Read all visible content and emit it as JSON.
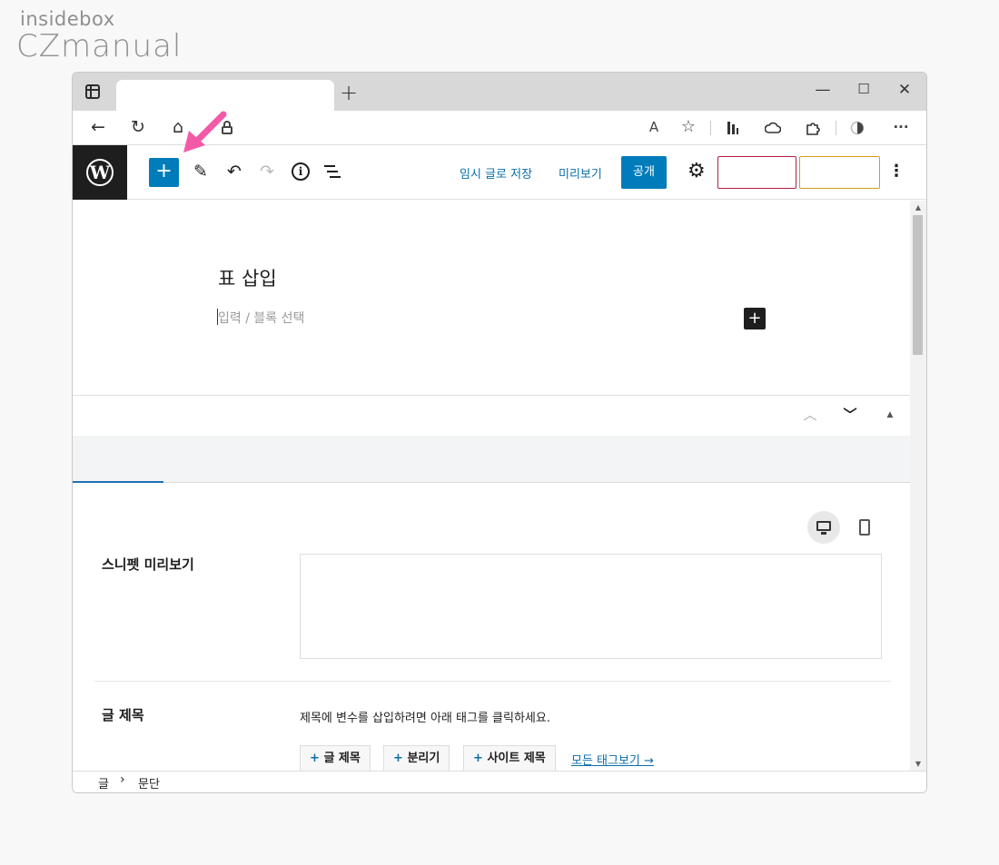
{
  "watermark": {
    "line1": "insidebox",
    "line2": "CZmanual"
  },
  "browser": {
    "new_tab_glyph": "+",
    "window_controls": {
      "minimize": "—",
      "maximize": "☐",
      "close": "✕"
    },
    "nav": {
      "back": "←",
      "reload": "↻",
      "home": "⌂"
    },
    "toolbar_icons": {
      "read_aloud": "A",
      "favorite": "☆",
      "more": "···"
    }
  },
  "wp_toolbar": {
    "logo_letter": "W",
    "insert_glyph": "+",
    "tools_glyph": "✎",
    "undo_glyph": "↶",
    "redo_glyph": "↷",
    "info_glyph": "i",
    "save_draft": "임시 글로 저장",
    "preview": "미리보기",
    "publish": "공개",
    "settings_glyph": "⚙",
    "options_glyph": "⋮",
    "accent_color": "#007cba"
  },
  "editor": {
    "post_title": "표 삽입",
    "placeholder": "입력 / 블록 선택",
    "block_add_glyph": "+"
  },
  "meta_box": {
    "move_up_glyph": "︿",
    "move_down_glyph": "﹀",
    "toggle_glyph": "▲",
    "snippet_preview_label": "스니펫 미리보기",
    "post_title_label": "글 제목",
    "help_text": "제목에 변수를 삽입하려면 아래 태그를 클릭하세요.",
    "tags": [
      {
        "plus": "+",
        "label": "글 제목"
      },
      {
        "plus": "+",
        "label": "분리기"
      },
      {
        "plus": "+",
        "label": "사이트 제목"
      }
    ],
    "all_tags_link": "모든 태그보기 →"
  },
  "breadcrumb": {
    "item1": "글",
    "separator": "›",
    "item2": "문단"
  },
  "colors": {
    "annotation_arrow": "#f25aa8",
    "link": "#0b6ea8",
    "btn_outline_red": "#b52040",
    "btn_outline_amber": "#d49b1f"
  }
}
